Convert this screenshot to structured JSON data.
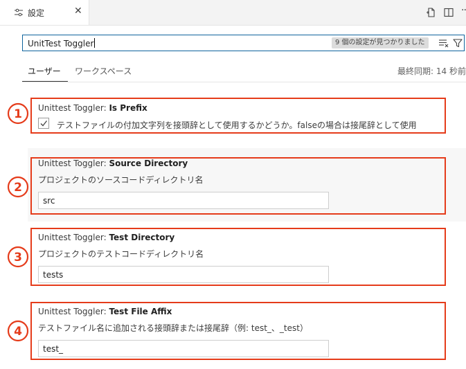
{
  "tab": {
    "title": "設定",
    "icon": "settings-sliders-icon",
    "close": "✕"
  },
  "actions": [
    "open-settings-json-icon",
    "split-editor-icon",
    "more-actions-icon"
  ],
  "search": {
    "value": "UnitTest Toggler",
    "result_count": "9 個の設定が見つかりました"
  },
  "scope_tabs": [
    "ユーザー",
    "ワークスペース"
  ],
  "active_scope": "ユーザー",
  "sync_status": "最終同期: 14 秒前",
  "colors": {
    "annotation_red": "#e53b1a",
    "focus_border": "#0e639c"
  },
  "settings": [
    {
      "number": "1",
      "category": "Unittest Toggler: ",
      "name": "Is Prefix",
      "type": "checkbox",
      "checked": true,
      "description": "テストファイルの付加文字列を接頭辞として使用するかどうか。falseの場合は接尾辞として使用"
    },
    {
      "number": "2",
      "category": "Unittest Toggler: ",
      "name": "Source Directory",
      "type": "text",
      "description": "プロジェクトのソースコードディレクトリ名",
      "value": "src"
    },
    {
      "number": "3",
      "category": "Unittest Toggler: ",
      "name": "Test Directory",
      "type": "text",
      "description": "プロジェクトのテストコードディレクトリ名",
      "value": "tests"
    },
    {
      "number": "4",
      "category": "Unittest Toggler: ",
      "name": "Test File Affix",
      "type": "text",
      "description": "テストファイル名に追加される接頭辞または接尾辞（例: test_、_test）",
      "value": "test_"
    }
  ]
}
